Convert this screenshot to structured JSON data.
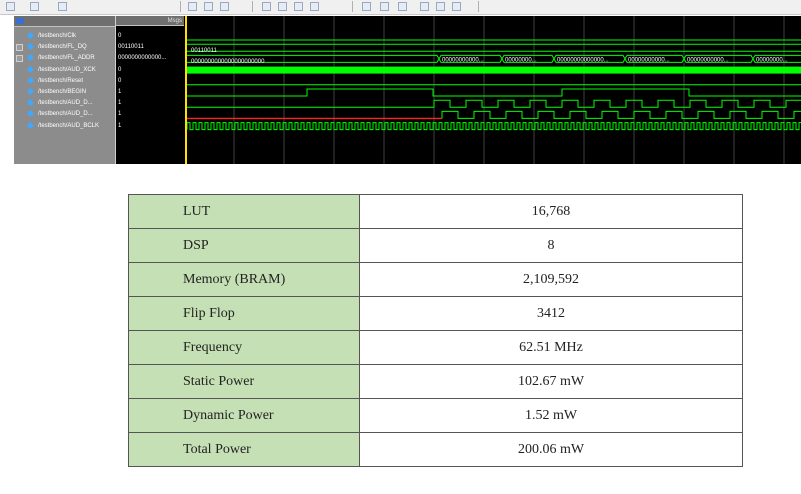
{
  "waveform": {
    "header_label": "Msgs",
    "signals": [
      {
        "name": "/testbench/Clk",
        "value": "0",
        "expandable": false
      },
      {
        "name": "/testbench/FL_DQ",
        "value": "00110011",
        "expandable": true
      },
      {
        "name": "/testbench/FL_ADDR",
        "value": "0000000000000...",
        "expandable": true
      },
      {
        "name": "/testbench/AUD_XCK",
        "value": "0",
        "expandable": false
      },
      {
        "name": "/testbench/Reset",
        "value": "0",
        "expandable": false
      },
      {
        "name": "/testbench/BEGIN",
        "value": "1",
        "expandable": false
      },
      {
        "name": "/testbench/AUD_D...",
        "value": "1",
        "expandable": false
      },
      {
        "name": "/testbench/AUD_D...",
        "value": "1",
        "expandable": false
      },
      {
        "name": "/testbench/AUD_BCLK",
        "value": "1",
        "expandable": false
      }
    ],
    "bus_labels": {
      "fl_dq": "00110011",
      "fl_addr_initial": "0000000000000000000000",
      "fl_addr_segments": [
        "00000000000...",
        "00000000...",
        "00000000000000...",
        "00000000000...",
        "00000000000...",
        "00000000..."
      ]
    }
  },
  "table": {
    "rows": [
      {
        "label": "LUT",
        "value": "16,768"
      },
      {
        "label": "DSP",
        "value": "8"
      },
      {
        "label": "Memory (BRAM)",
        "value": "2,109,592"
      },
      {
        "label": "Flip Flop",
        "value": "3412"
      },
      {
        "label": "Frequency",
        "value": "62.51 MHz"
      },
      {
        "label": "Static Power",
        "value": "102.67 mW"
      },
      {
        "label": "Dynamic Power",
        "value": "1.52 mW"
      },
      {
        "label": "Total Power",
        "value": "200.06 mW"
      }
    ]
  }
}
